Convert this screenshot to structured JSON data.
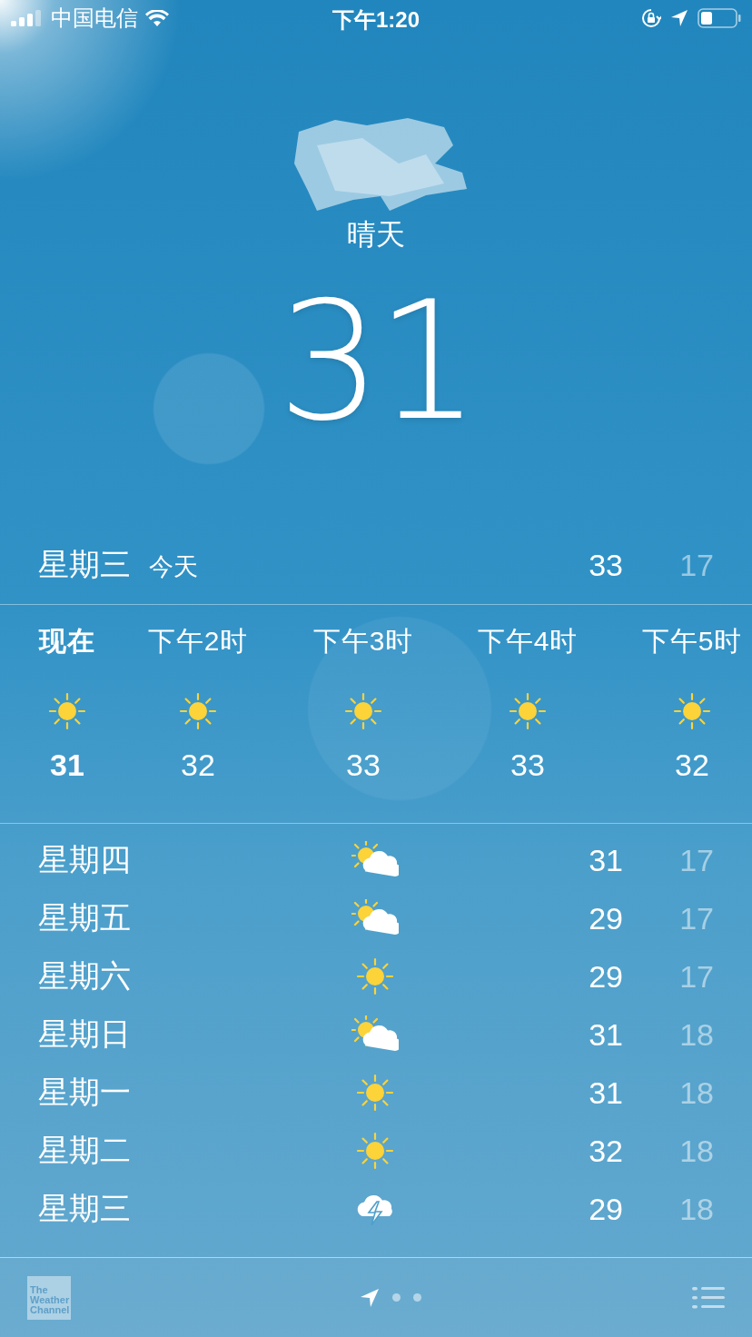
{
  "status_bar": {
    "carrier": "中国电信",
    "time": "下午1:20"
  },
  "current": {
    "condition": "晴天",
    "temperature": "31"
  },
  "today": {
    "day": "星期三",
    "label": "今天",
    "high": "33",
    "low": "17"
  },
  "hourly": [
    {
      "label": "现在",
      "kind": "sunny",
      "temp": "31",
      "now": true
    },
    {
      "label": "下午2时",
      "kind": "sunny",
      "temp": "32",
      "now": false
    },
    {
      "label": "下午3时",
      "kind": "sunny",
      "temp": "33",
      "now": false
    },
    {
      "label": "下午4时",
      "kind": "sunny",
      "temp": "33",
      "now": false
    },
    {
      "label": "下午5时",
      "kind": "sunny",
      "temp": "32",
      "now": false
    }
  ],
  "daily": [
    {
      "day": "星期四",
      "kind": "partly-cloudy",
      "high": "31",
      "low": "17"
    },
    {
      "day": "星期五",
      "kind": "partly-cloudy",
      "high": "29",
      "low": "17"
    },
    {
      "day": "星期六",
      "kind": "sunny",
      "high": "29",
      "low": "17"
    },
    {
      "day": "星期日",
      "kind": "partly-cloudy",
      "high": "31",
      "low": "18"
    },
    {
      "day": "星期一",
      "kind": "sunny",
      "high": "31",
      "low": "18"
    },
    {
      "day": "星期二",
      "kind": "sunny",
      "high": "32",
      "low": "18"
    },
    {
      "day": "星期三",
      "kind": "thunderstorm",
      "high": "29",
      "low": "18"
    }
  ],
  "toolbar": {
    "provider_logo": "The Weather Channel",
    "pages": [
      {
        "kind": "location",
        "selected": true
      },
      {
        "kind": "dot",
        "selected": false
      },
      {
        "kind": "dot",
        "selected": false
      }
    ]
  }
}
